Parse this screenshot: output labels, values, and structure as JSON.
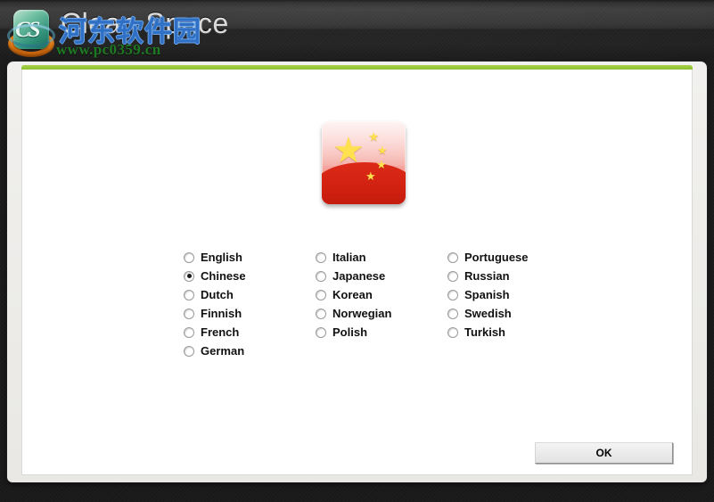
{
  "window": {
    "title": "Clean Space",
    "logo_icon": "cleanspace-logo-icon"
  },
  "watermark": {
    "cjk_text": "河东软件园",
    "url_text": "www.pc0359.cn",
    "cjk_color": "#2f6fc4",
    "url_color": "#1e7a22"
  },
  "panel": {
    "accent_color": "#8dbf30",
    "background_color": "#ffffff"
  },
  "flag": {
    "icon": "china-flag-icon",
    "stars": [
      "★",
      "★",
      "★",
      "★",
      "★"
    ],
    "red": "#cf1f0f",
    "star_color": "#ffe14f"
  },
  "languages": {
    "selected": "Chinese",
    "columns": [
      {
        "items": [
          {
            "label": "English",
            "selected": false
          },
          {
            "label": "Chinese",
            "selected": true
          },
          {
            "label": "Dutch",
            "selected": false
          },
          {
            "label": "Finnish",
            "selected": false
          },
          {
            "label": "French",
            "selected": false
          },
          {
            "label": "German",
            "selected": false
          }
        ]
      },
      {
        "items": [
          {
            "label": "Italian",
            "selected": false
          },
          {
            "label": "Japanese",
            "selected": false
          },
          {
            "label": "Korean",
            "selected": false
          },
          {
            "label": "Norwegian",
            "selected": false
          },
          {
            "label": "Polish",
            "selected": false
          }
        ]
      },
      {
        "items": [
          {
            "label": "Portuguese",
            "selected": false
          },
          {
            "label": "Russian",
            "selected": false
          },
          {
            "label": "Spanish",
            "selected": false
          },
          {
            "label": "Swedish",
            "selected": false
          },
          {
            "label": "Turkish",
            "selected": false
          }
        ]
      }
    ]
  },
  "buttons": {
    "ok_label": "OK"
  }
}
